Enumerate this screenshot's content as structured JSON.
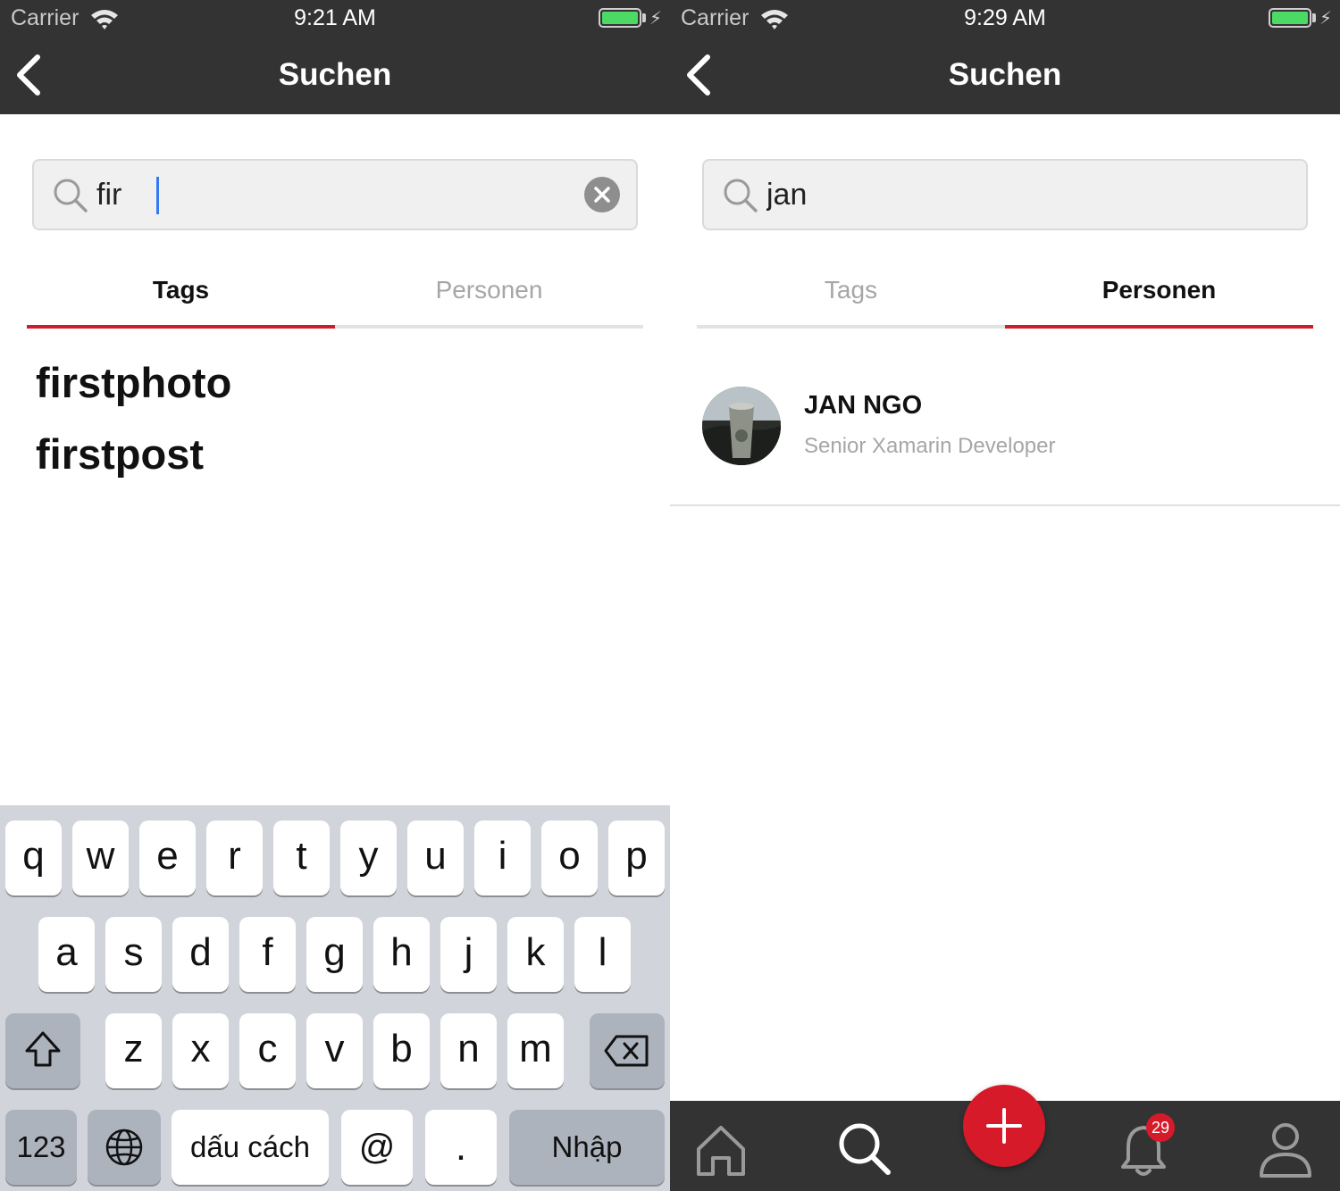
{
  "left": {
    "status": {
      "carrier": "Carrier",
      "time": "9:21 AM"
    },
    "nav_title": "Suchen",
    "search": {
      "value": "fir"
    },
    "tabs": [
      {
        "label": "Tags",
        "active": true
      },
      {
        "label": "Personen",
        "active": false
      }
    ],
    "tag_results": [
      "firstphoto",
      "firstpost"
    ],
    "keyboard": {
      "row1": [
        "q",
        "w",
        "e",
        "r",
        "t",
        "y",
        "u",
        "i",
        "o",
        "p"
      ],
      "row2": [
        "a",
        "s",
        "d",
        "f",
        "g",
        "h",
        "j",
        "k",
        "l"
      ],
      "row3": [
        "z",
        "x",
        "c",
        "v",
        "b",
        "n",
        "m"
      ],
      "numbers_label": "123",
      "space_label": "dấu cách",
      "at_label": "@",
      "dot_label": ".",
      "return_label": "Nhập"
    }
  },
  "right": {
    "status": {
      "carrier": "Carrier",
      "time": "9:29 AM"
    },
    "nav_title": "Suchen",
    "search": {
      "value": "jan"
    },
    "tabs": [
      {
        "label": "Tags",
        "active": false
      },
      {
        "label": "Personen",
        "active": true
      }
    ],
    "people": [
      {
        "name": "JAN NGO",
        "role": "Senior Xamarin Developer"
      }
    ],
    "tabbar": {
      "items": [
        "home-icon",
        "search-icon",
        "add-icon",
        "bell-icon",
        "profile-icon"
      ],
      "notification_count": "29"
    }
  },
  "colors": {
    "header": "#333333",
    "accent": "#cf1b2b",
    "battery": "#4cd964",
    "keyboard": "#d1d4da"
  }
}
